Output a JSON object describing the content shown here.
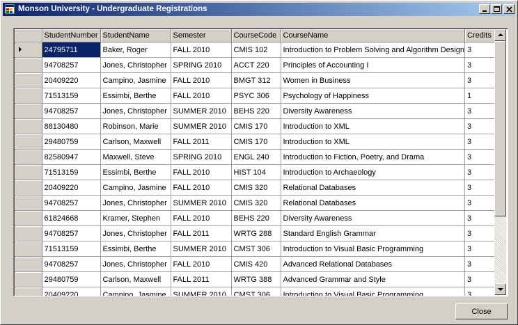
{
  "window": {
    "title": "Monson University - Undergraduate Registrations",
    "close_label": "Close"
  },
  "grid": {
    "columns": [
      "StudentNumber",
      "StudentName",
      "Semester",
      "CourseCode",
      "CourseName",
      "Credits"
    ],
    "rows": [
      [
        "24795711",
        "Baker, Roger",
        "FALL 2010",
        "CMIS 102",
        "Introduction to Problem Solving and Algorithm Design",
        "3"
      ],
      [
        "94708257",
        "Jones, Christopher",
        "SPRING 2010",
        "ACCT 220",
        "Principles of Accounting I",
        "3"
      ],
      [
        "20409220",
        "Campino, Jasmine",
        "FALL 2010",
        "BMGT 312",
        "Women in Business",
        "3"
      ],
      [
        "71513159",
        "Essimbi, Berthe",
        "FALL 2010",
        "PSYC 306",
        "Psychology of Happiness",
        "1"
      ],
      [
        "94708257",
        "Jones, Christopher",
        "SUMMER 2010",
        "BEHS 220",
        "Diversity Awareness",
        "3"
      ],
      [
        "88130480",
        "Robinson, Marie",
        "SUMMER 2010",
        "CMIS 170",
        "Introduction to XML",
        "3"
      ],
      [
        "29480759",
        "Carlson, Maxwell",
        "FALL 2011",
        "CMIS 170",
        "Introduction to XML",
        "3"
      ],
      [
        "82580947",
        "Maxwell, Steve",
        "SPRING 2010",
        "ENGL 240",
        "Introduction to Fiction, Poetry, and Drama",
        "3"
      ],
      [
        "71513159",
        "Essimbi, Berthe",
        "FALL 2010",
        "HIST 104",
        "Introduction to Archaeology",
        "3"
      ],
      [
        "20409220",
        "Campino, Jasmine",
        "FALL 2010",
        "CMIS 320",
        "Relational Databases",
        "3"
      ],
      [
        "94708257",
        "Jones, Christopher",
        "SUMMER 2010",
        "CMIS 320",
        "Relational Databases",
        "3"
      ],
      [
        "61824668",
        "Kramer, Stephen",
        "FALL 2010",
        "BEHS 220",
        "Diversity Awareness",
        "3"
      ],
      [
        "94708257",
        "Jones, Christopher",
        "FALL 2011",
        "WRTG 288",
        "Standard English Grammar",
        "3"
      ],
      [
        "71513159",
        "Essimbi, Berthe",
        "SUMMER 2010",
        "CMST 306",
        "Introduction to Visual Basic Programming",
        "3"
      ],
      [
        "94708257",
        "Jones, Christopher",
        "FALL 2010",
        "CMIS 420",
        "Advanced Relational Databases",
        "3"
      ],
      [
        "29480759",
        "Carlson, Maxwell",
        "FALL 2011",
        "WRTG 388",
        "Advanced Grammar and Style",
        "3"
      ],
      [
        "20409220",
        "Campino, Jasmine",
        "SUMMER 2010",
        "CMST 306",
        "Introduction to Visual Basic Programming",
        "3"
      ]
    ],
    "selected_row": 0,
    "selected_col": 0
  },
  "icons": {
    "app": "app-icon",
    "minimize": "minimize-icon",
    "maximize": "maximize-icon",
    "close": "close-icon",
    "scroll_up": "scroll-up-icon",
    "scroll_down": "scroll-down-icon",
    "current_row": "current-row-arrow-icon"
  },
  "colors": {
    "title_start": "#0a246a",
    "title_end": "#a6caf0",
    "selection": "#0a246a",
    "face": "#d4d0c8"
  }
}
